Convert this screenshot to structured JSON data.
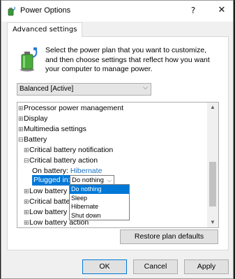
{
  "window": {
    "title": "Power Options",
    "help_glyph": "?",
    "close_glyph": "✕",
    "icon": "power-options-icon"
  },
  "tab": {
    "label": "Advanced settings"
  },
  "description": "Select the power plan that you want to customize, and then choose settings that reflect how you want your computer to manage power.",
  "plan_select": {
    "value": "Balanced [Active]",
    "chevron": "⌵"
  },
  "tree": {
    "items": [
      {
        "toggle": "⊞",
        "label": "Processor power management"
      },
      {
        "toggle": "⊞",
        "label": "Display"
      },
      {
        "toggle": "⊞",
        "label": "Multimedia settings"
      },
      {
        "toggle": "⊟",
        "label": "Battery"
      },
      {
        "toggle": "⊞",
        "label": "Critical battery notification"
      },
      {
        "toggle": "⊟",
        "label": "Critical battery action"
      },
      {
        "label": "On battery:",
        "value": "Hibernate"
      },
      {
        "label": "Plugged in:",
        "value": "Do nothing"
      },
      {
        "toggle": "⊞",
        "label": "Low battery le"
      },
      {
        "toggle": "⊞",
        "label": "Critical batter"
      },
      {
        "toggle": "⊞",
        "label": "Low battery n"
      },
      {
        "toggle": "⊞",
        "label": "Low battery action"
      }
    ]
  },
  "dropdown": {
    "chevron": "⌵",
    "options": [
      "Do nothing",
      "Sleep",
      "Hibernate",
      "Shut down"
    ],
    "selected": "Do nothing"
  },
  "scroll_glyphs": {
    "up": "▲",
    "down": "▼"
  },
  "buttons": {
    "restore": "Restore plan defaults",
    "ok": "OK",
    "cancel": "Cancel",
    "apply": "Apply"
  },
  "colors": {
    "accent": "#0078d7",
    "link": "#1a6fbf"
  }
}
